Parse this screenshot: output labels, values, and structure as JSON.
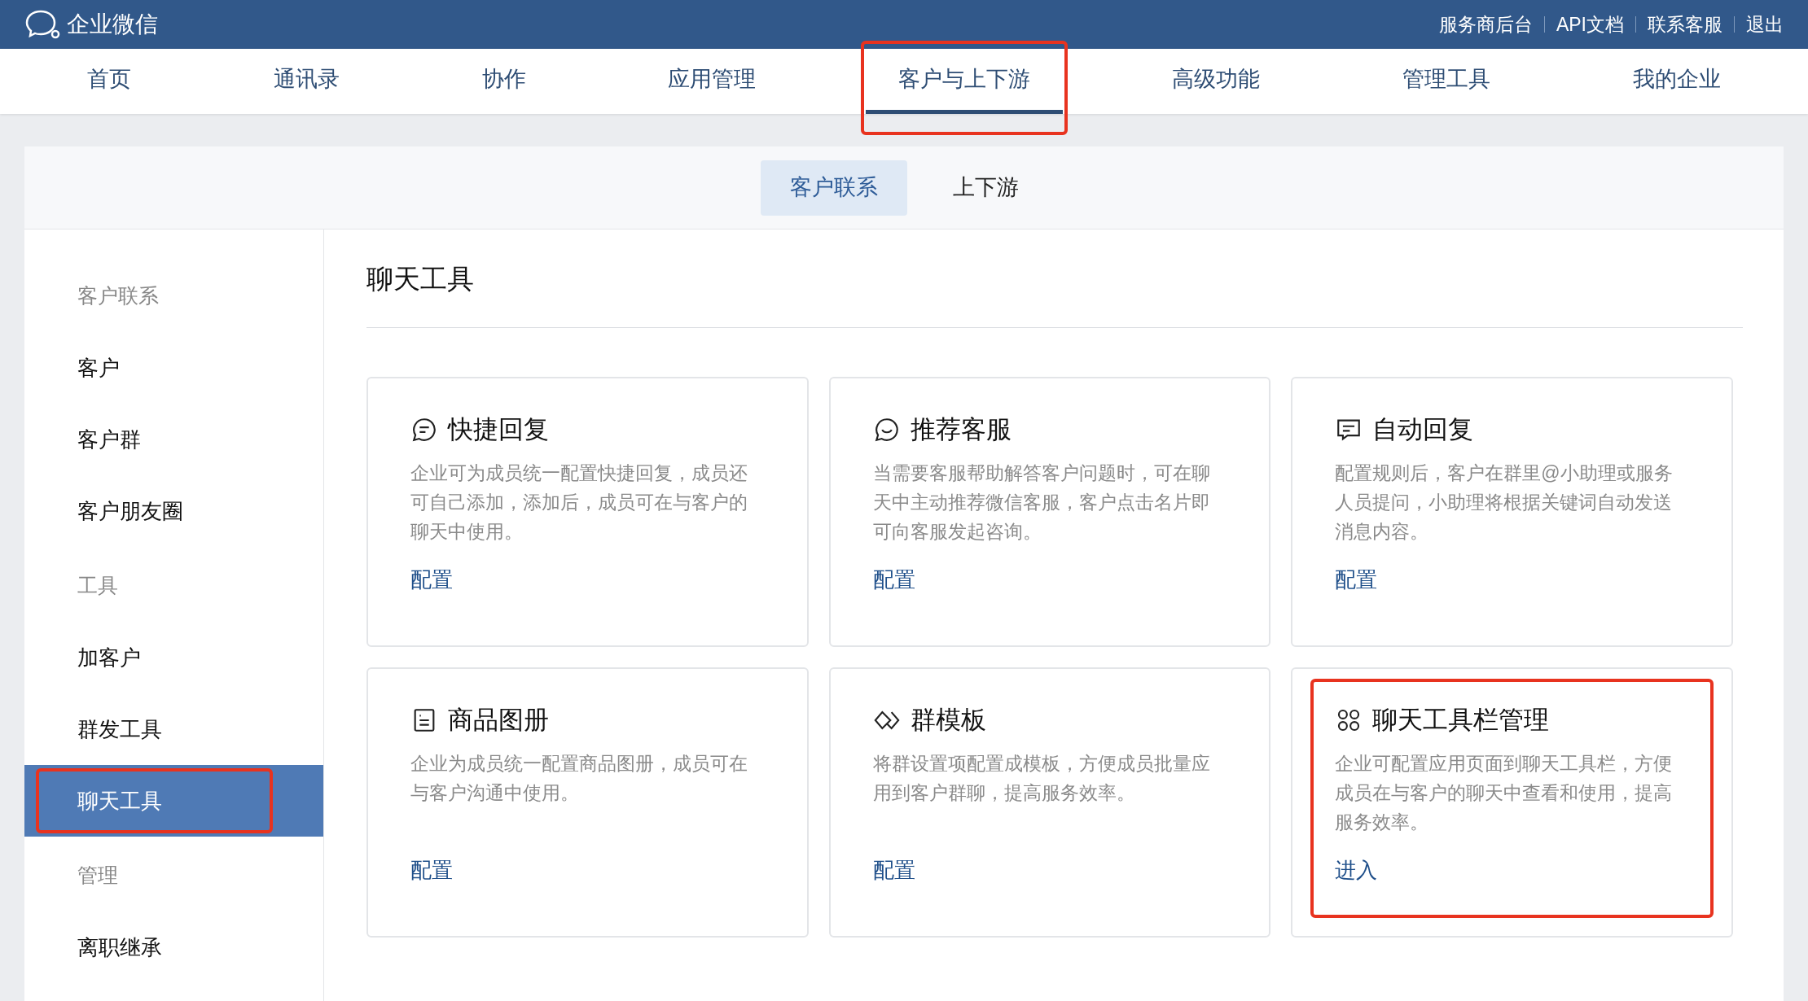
{
  "topbar": {
    "brand": "企业微信",
    "links": [
      "服务商后台",
      "API文档",
      "联系客服",
      "退出"
    ]
  },
  "nav": [
    {
      "label": "首页",
      "selected": false,
      "highlighted": false
    },
    {
      "label": "通讯录",
      "selected": false,
      "highlighted": false
    },
    {
      "label": "协作",
      "selected": false,
      "highlighted": false
    },
    {
      "label": "应用管理",
      "selected": false,
      "highlighted": false
    },
    {
      "label": "客户与上下游",
      "selected": true,
      "highlighted": true
    },
    {
      "label": "高级功能",
      "selected": false,
      "highlighted": false
    },
    {
      "label": "管理工具",
      "selected": false,
      "highlighted": false
    },
    {
      "label": "我的企业",
      "selected": false,
      "highlighted": false
    }
  ],
  "subtabs": [
    {
      "label": "客户联系",
      "selected": true
    },
    {
      "label": "上下游",
      "selected": false
    }
  ],
  "sidebar": [
    {
      "kind": "section",
      "label": "客户联系"
    },
    {
      "kind": "item",
      "label": "客户",
      "selected": false,
      "highlighted": false
    },
    {
      "kind": "item",
      "label": "客户群",
      "selected": false,
      "highlighted": false
    },
    {
      "kind": "item",
      "label": "客户朋友圈",
      "selected": false,
      "highlighted": false
    },
    {
      "kind": "section",
      "label": "工具"
    },
    {
      "kind": "item",
      "label": "加客户",
      "selected": false,
      "highlighted": false
    },
    {
      "kind": "item",
      "label": "群发工具",
      "selected": false,
      "highlighted": false
    },
    {
      "kind": "item",
      "label": "聊天工具",
      "selected": true,
      "highlighted": true
    },
    {
      "kind": "section",
      "label": "管理"
    },
    {
      "kind": "item",
      "label": "离职继承",
      "selected": false,
      "highlighted": false
    }
  ],
  "page_title": "聊天工具",
  "cards": [
    {
      "kind": "quick-reply",
      "title": "快捷回复",
      "description": "企业可为成员统一配置快捷回复，成员还可自己添加，添加后，成员可在与客户的聊天中使用。",
      "action": "配置",
      "highlighted": false
    },
    {
      "kind": "recommend",
      "title": "推荐客服",
      "description": "当需要客服帮助解答客户问题时，可在聊天中主动推荐微信客服，客户点击名片即可向客服发起咨询。",
      "action": "配置",
      "highlighted": false
    },
    {
      "kind": "auto-reply",
      "title": "自动回复",
      "description": "配置规则后，客户在群里@小助理或服务人员提问，小助理将根据关键词自动发送消息内容。",
      "action": "配置",
      "highlighted": false
    },
    {
      "kind": "catalog",
      "title": "商品图册",
      "description": "企业为成员统一配置商品图册，成员可在与客户沟通中使用。",
      "action": "配置",
      "highlighted": false
    },
    {
      "kind": "template",
      "title": "群模板",
      "description": "将群设置项配置成模板，方便成员批量应用到客户群聊，提高服务效率。",
      "action": "配置",
      "highlighted": false
    },
    {
      "kind": "toolbar",
      "title": "聊天工具栏管理",
      "description": "企业可配置应用页面到聊天工具栏，方便成员在与客户的聊天中查看和使用，提高服务效率。",
      "action": "进入",
      "highlighted": true
    }
  ]
}
